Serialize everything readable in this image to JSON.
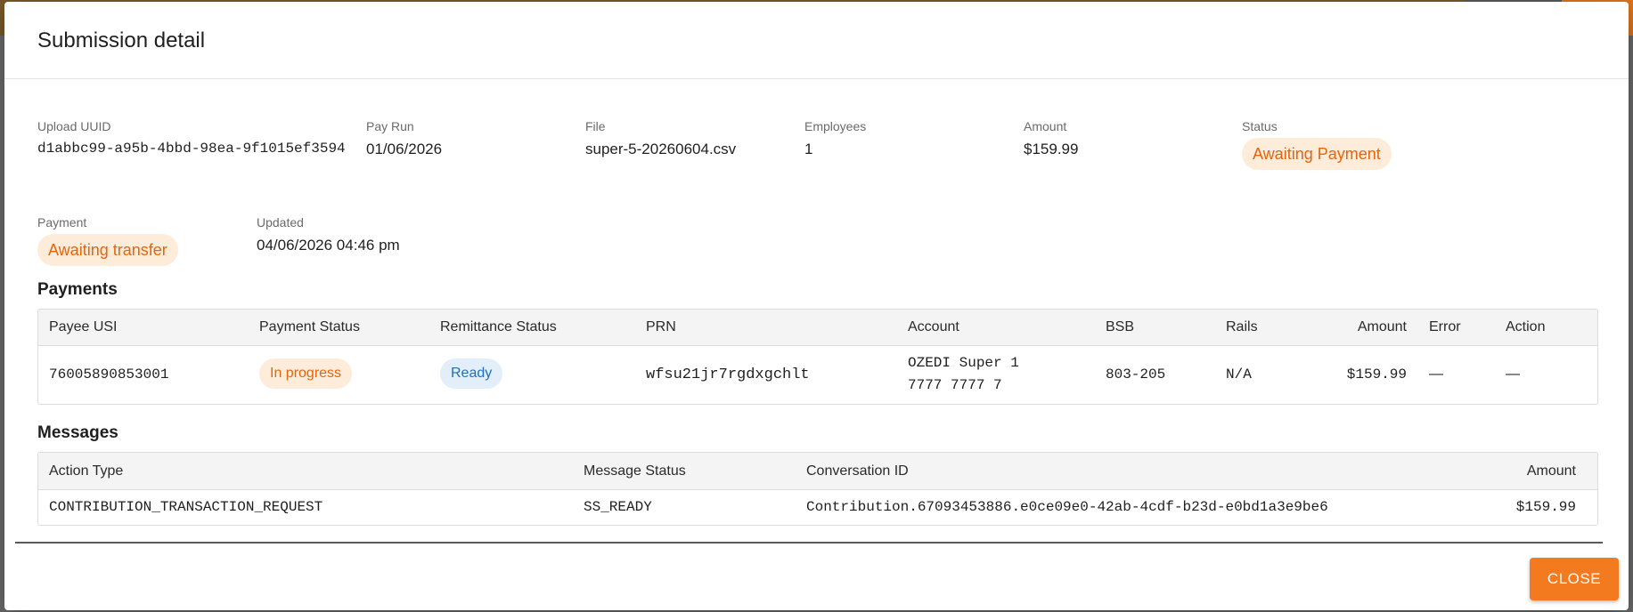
{
  "dialog": {
    "title": "Submission detail",
    "close_label": "CLOSE"
  },
  "summary": {
    "upload_uuid": {
      "label": "Upload UUID",
      "value": "d1abbc99-a95b-4bbd-98ea-9f1015ef3594"
    },
    "pay_run": {
      "label": "Pay Run",
      "value": "01/06/2026"
    },
    "file": {
      "label": "File",
      "value": "super-5-20260604.csv"
    },
    "employees": {
      "label": "Employees",
      "value": "1"
    },
    "amount": {
      "label": "Amount",
      "value": "$159.99"
    },
    "status": {
      "label": "Status",
      "value": "Awaiting Payment"
    },
    "payment": {
      "label": "Payment",
      "value": "Awaiting transfer"
    },
    "updated": {
      "label": "Updated",
      "value": "04/06/2026 04:46 pm"
    }
  },
  "payments": {
    "title": "Payments",
    "headers": [
      "Payee USI",
      "Payment Status",
      "Remittance Status",
      "PRN",
      "Account",
      "BSB",
      "Rails",
      "Amount",
      "Error",
      "Action"
    ],
    "rows": [
      {
        "payee_usi": "76005890853001",
        "payment_status": "In progress",
        "remittance_status": "Ready",
        "prn": "wfsu21jr7rgdxgchlt",
        "account_name": "OZEDI Super 1",
        "account_number": "7777 7777 7",
        "bsb": "803-205",
        "rails": "N/A",
        "amount": "$159.99",
        "error": "—",
        "action": "—"
      }
    ]
  },
  "messages": {
    "title": "Messages",
    "headers": [
      "Action Type",
      "Message Status",
      "Conversation ID",
      "Amount"
    ],
    "rows": [
      {
        "action_type": "CONTRIBUTION_TRANSACTION_REQUEST",
        "message_status": "SS_READY",
        "conversation_id": "Contribution.67093453886.e0ce09e0-42ab-4cdf-b23d-e0bd1a3e9be6",
        "amount": "$159.99"
      }
    ]
  },
  "colors": {
    "accent": "#f47a1f",
    "warning_chip_bg": "#fdecd9",
    "warning_chip_text": "#e4650c",
    "info_chip_bg": "#e2eef9",
    "info_chip_text": "#1e6fc1"
  }
}
